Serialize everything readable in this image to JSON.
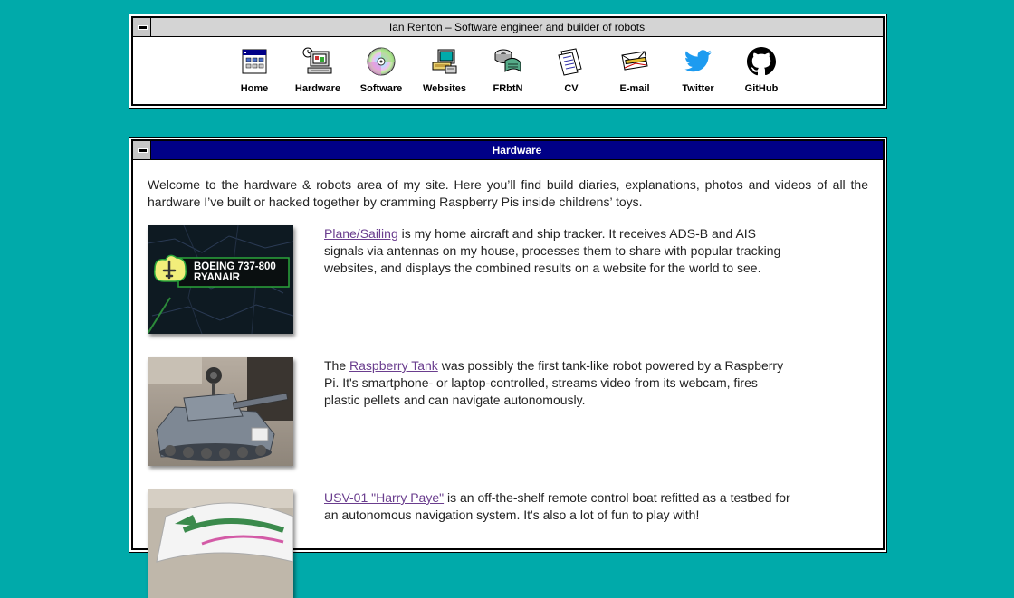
{
  "nav_window": {
    "title": "Ian Renton – Software engineer and builder of robots"
  },
  "nav": [
    {
      "label": "Home",
      "icon": "home-icon"
    },
    {
      "label": "Hardware",
      "icon": "hardware-icon"
    },
    {
      "label": "Software",
      "icon": "software-icon"
    },
    {
      "label": "Websites",
      "icon": "websites-icon"
    },
    {
      "label": "FRbtN",
      "icon": "frbtn-icon"
    },
    {
      "label": "CV",
      "icon": "cv-icon"
    },
    {
      "label": "E-mail",
      "icon": "email-icon"
    },
    {
      "label": "Twitter",
      "icon": "twitter-icon"
    },
    {
      "label": "GitHub",
      "icon": "github-icon"
    }
  ],
  "hardware_window": {
    "title": "Hardware",
    "intro": "Welcome to the hardware & robots area of my site. Here you’ll find build diaries, explanations, photos and videos of all the hardware I’ve built or hacked together by cramming Raspberry Pis inside childrens’ toys.",
    "items": [
      {
        "prefix": "",
        "link": "Plane/Sailing",
        "suffix": " is my home aircraft and ship tracker. It receives ADS-B and AIS signals via antennas on my house, processes them to share with popular tracking websites, and displays the combined results on a website for the world to see.",
        "thumb_label_1": "BOEING 737-800",
        "thumb_label_2": "RYANAIR"
      },
      {
        "prefix": "The ",
        "link": "Raspberry Tank",
        "suffix": " was possibly the first tank-like robot powered by a Raspberry Pi. It's smartphone- or laptop-controlled, streams video from its webcam, fires plastic pellets and can navigate autonomously."
      },
      {
        "prefix": "",
        "link": "USV-01 \"Harry Paye\"",
        "suffix": " is an off-the-shelf remote control boat refitted as a testbed for an autonomous navigation system. It's also a lot of fun to play with!"
      }
    ]
  },
  "colors": {
    "desktop": "#00aaaa",
    "active_title": "#000087",
    "link": "#6a3d8e"
  }
}
